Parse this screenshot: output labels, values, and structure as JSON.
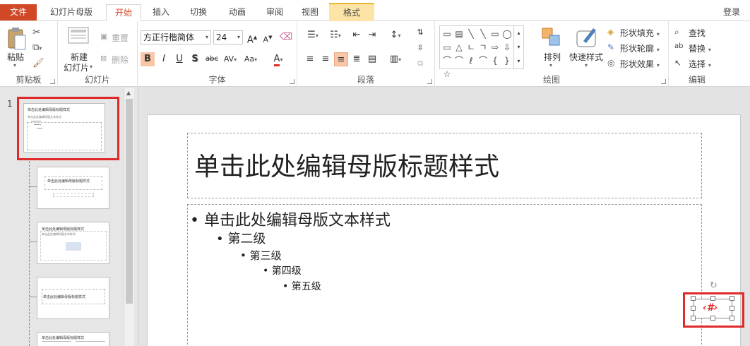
{
  "tabs": {
    "file": "文件",
    "master": "幻灯片母版",
    "home": "开始",
    "insert": "插入",
    "transitions": "切换",
    "animations": "动画",
    "review": "审阅",
    "view": "视图",
    "format": "格式"
  },
  "account": {
    "login": "登录"
  },
  "clipboard": {
    "paste": "粘贴",
    "label": "剪贴板"
  },
  "slides_group": {
    "new_slide_line1": "新建",
    "new_slide_line2": "幻灯片",
    "reset": "重置",
    "delete": "删除",
    "label": "幻灯片"
  },
  "font": {
    "family": "方正行楷简体",
    "size": "24",
    "grow": "A",
    "shrink": "A",
    "bold": "B",
    "italic": "I",
    "underline": "U",
    "shadow": "S",
    "strike": "abc",
    "spacing": "AV",
    "case": "Aa",
    "color_letter": "A",
    "label": "字体"
  },
  "paragraph": {
    "label": "段落"
  },
  "drawing": {
    "arrange": "排列",
    "quick_styles": "快速样式",
    "shape_fill": "形状填充",
    "shape_outline": "形状轮廓",
    "shape_effects": "形状效果",
    "label": "绘图",
    "shape_symbols": [
      "▭",
      "▤",
      "╲",
      "╲",
      "▭",
      "◯",
      "▭",
      "△",
      "ㄴ",
      "ㄱ",
      "⇨",
      "⇩",
      "⌒",
      "⌒",
      "ℓ",
      "⌒",
      "{",
      "}",
      "☆"
    ]
  },
  "editing": {
    "find": "查找",
    "replace": "替换",
    "select": "选择",
    "label": "编辑"
  },
  "thumbnails": {
    "number": "1",
    "title_text": "单击此处编辑母版标题样式",
    "body_text": "单击此处编辑母版文本样式"
  },
  "slide": {
    "title": "单击此处编辑母版标题样式",
    "levels": [
      "单击此处编辑母版文本样式",
      "第二级",
      "第三级",
      "第四级",
      "第五级"
    ],
    "slide_number_field": "‹#›"
  },
  "colors": {
    "accent": "#d24726",
    "highlight": "#e0292a",
    "selected_button": "#f9c7a8"
  }
}
